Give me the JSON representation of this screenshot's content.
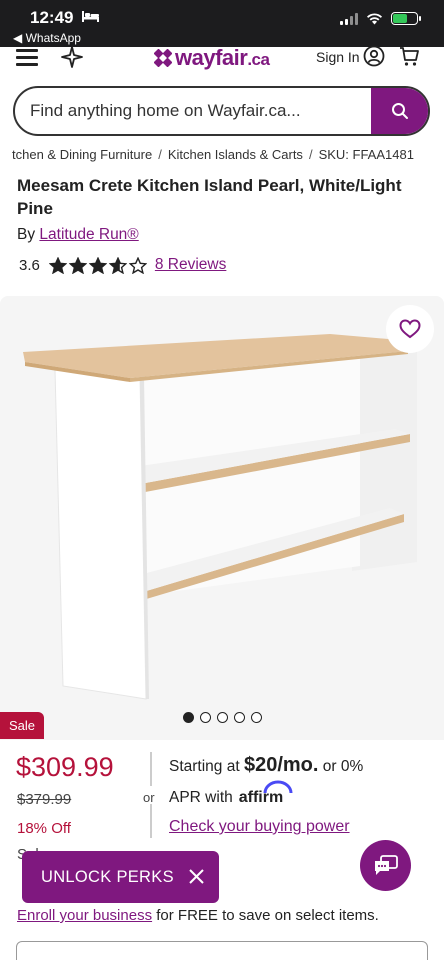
{
  "status_bar": {
    "time": "12:49",
    "back_app": "◀ WhatsApp",
    "battery_percent": 60
  },
  "header": {
    "logo": "wayfair",
    "logo_suffix": ".ca",
    "signin": "Sign In"
  },
  "search": {
    "placeholder": "Find anything home on Wayfair.ca..."
  },
  "breadcrumb": {
    "items": [
      "tchen & Dining Furniture",
      "Kitchen Islands & Carts"
    ],
    "sku": "SKU: FFAA1481"
  },
  "product": {
    "title": "Meesam Crete Kitchen Island Pearl, White/Light Pine",
    "by_prefix": "By",
    "brand": "Latitude Run®",
    "rating": "3.6",
    "rating_value": 3.6,
    "reviews": "8 Reviews"
  },
  "gallery": {
    "image_count": 5,
    "active_index": 0,
    "sale_badge": "Sale"
  },
  "pricing": {
    "price": "$309.99",
    "was_price": "$379.99",
    "percent_off": "18% Off",
    "sale_ends": "Sale",
    "or": "or",
    "financing_prefix": "Starting at",
    "financing_amount": "$20/mo.",
    "financing_suffix": "or 0%",
    "apr_prefix": "APR with",
    "affirm": "affirm",
    "check_power": "Check your buying power"
  },
  "perks": {
    "label": "UNLOCK PERKS"
  },
  "pro": {
    "prefix": "F",
    "link": "Enroll your business",
    "text": "for FREE to save on select items."
  },
  "colors": {
    "brand": "#7f187f",
    "sale": "#b5123b"
  }
}
